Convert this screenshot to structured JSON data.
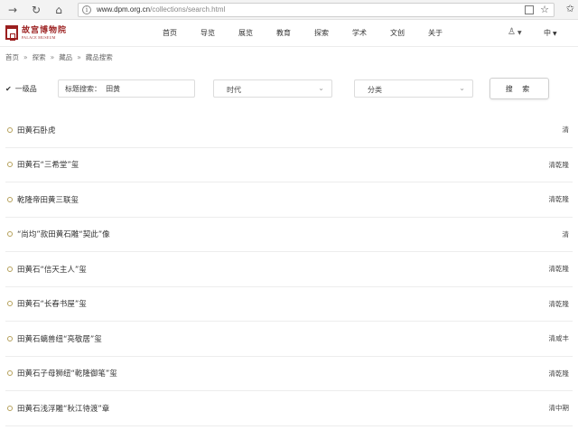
{
  "browser": {
    "url_host": "www.dpm.org.cn",
    "url_path": "/collections/search.html"
  },
  "site": {
    "logo_cn": "故宫博物院",
    "logo_en": "PALACE MUSEUM",
    "menu": [
      "首页",
      "导览",
      "展览",
      "教育",
      "探索",
      "学术",
      "文创",
      "关于"
    ],
    "lang": "中"
  },
  "breadcrumb": [
    "首页",
    "探索",
    "藏品",
    "藏品搜索"
  ],
  "filters": {
    "first_grade_label": "一级品",
    "keyword_value": "标题搜索：  田黄",
    "era_label": "时代",
    "category_label": "分类",
    "search_label": "搜 索"
  },
  "results": [
    {
      "title": "田黄石卧虎",
      "era": "清"
    },
    {
      "title": "田黄石“三希堂”玺",
      "era": "清乾隆"
    },
    {
      "title": "乾隆帝田黄三联玺",
      "era": "清乾隆"
    },
    {
      "title": "“尚均”款田黄石雕“契此”像",
      "era": "清"
    },
    {
      "title": "田黄石“信天主人”玺",
      "era": "清乾隆"
    },
    {
      "title": "田黄石“长春书屋”玺",
      "era": "清乾隆"
    },
    {
      "title": "田黄石螭兽纽“亮敬居”玺",
      "era": "清咸丰"
    },
    {
      "title": "田黄石子母狮纽“乾隆御笔”玺",
      "era": "清乾隆"
    },
    {
      "title": "田黄石浅浮雕“秋江待渡”章",
      "era": "清中期"
    }
  ]
}
